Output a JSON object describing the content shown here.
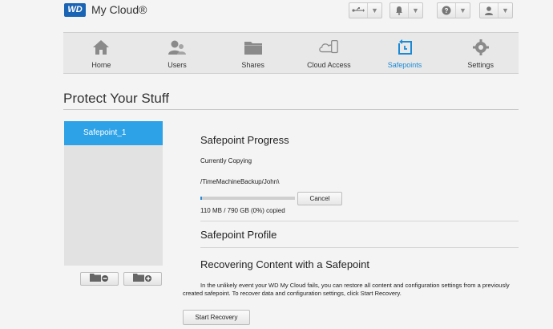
{
  "header": {
    "logo_text": "WD",
    "brand": "My Cloud®",
    "toolbar": [
      {
        "icon": "usb-icon"
      },
      {
        "icon": "bell-icon"
      },
      {
        "icon": "help-icon"
      },
      {
        "icon": "user-icon"
      }
    ]
  },
  "nav": {
    "items": [
      {
        "label": "Home",
        "icon": "home-icon",
        "active": false
      },
      {
        "label": "Users",
        "icon": "users-icon",
        "active": false
      },
      {
        "label": "Shares",
        "icon": "folder-icon",
        "active": false
      },
      {
        "label": "Cloud Access",
        "icon": "cloud-device-icon",
        "active": false
      },
      {
        "label": "Safepoints",
        "icon": "safepoint-icon",
        "active": true
      },
      {
        "label": "Settings",
        "icon": "gear-icon",
        "active": false
      }
    ],
    "accent": "#1b8ad6"
  },
  "page": {
    "title": "Protect Your Stuff"
  },
  "safepoints": {
    "items": [
      "Safepoint_1"
    ],
    "selected_color": "#2ea2e6"
  },
  "progress": {
    "heading": "Safepoint Progress",
    "status": "Currently Copying",
    "path": "/TimeMachineBackup/John\\",
    "fraction": 0.02,
    "cancel_label": "Cancel",
    "copied_text": "110 MB  /  790 GB (0%)  copied"
  },
  "profile": {
    "heading": "Safepoint Profile"
  },
  "recovery": {
    "heading": "Recovering Content with a Safepoint",
    "description": "In the unlikely event your WD My Cloud fails, you can restore all content and configuration settings from a previously created safepoint. To recover data and configuration settings, click Start Recovery.",
    "button_label": "Start Recovery"
  }
}
